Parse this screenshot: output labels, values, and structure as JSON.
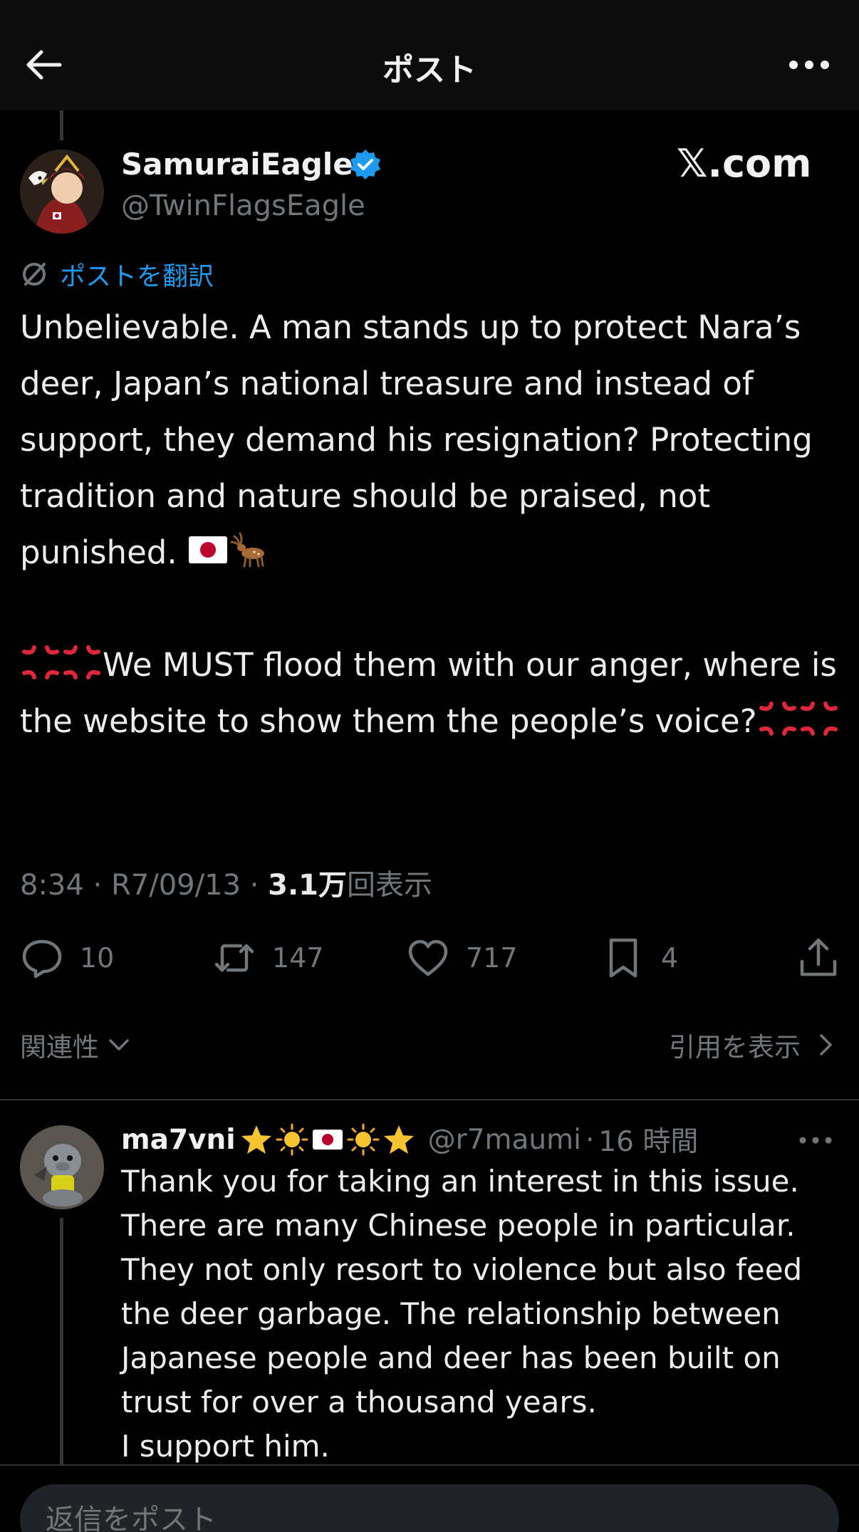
{
  "header": {
    "title": "ポスト",
    "back_icon": "arrow-left-icon",
    "more_icon": "more-horizontal-icon"
  },
  "author": {
    "display_name": "SamuraiEagle",
    "handle": "@TwinFlagsEagle",
    "verified": true,
    "brand_label": "𝕏.com"
  },
  "translate": {
    "label": "ポストを翻訳"
  },
  "post": {
    "line1": "Unbelievable. A man stands up to protect Nara’s deer, Japan’s national treasure and instead of support, they demand his resignation? Protecting tradition and nature should be praised, not punished. ",
    "line2": "We MUST flood them with our anger, where is the website to show them the people’s voice?",
    "emojis_first": [
      "flag-japan",
      "deer"
    ],
    "emojis_anger": [
      "anger-symbol",
      "anger-symbol"
    ]
  },
  "meta": {
    "time": "8:34",
    "separator": "·",
    "date": "R7/09/13",
    "views_num": "3.1万",
    "views_label": "回表示"
  },
  "actions": {
    "replies": "10",
    "reposts": "147",
    "likes": "717",
    "bookmarks": "4"
  },
  "filters": {
    "sort_label": "関連性",
    "quotes_label": "引用を表示"
  },
  "reply": {
    "display_name": "ma7vni",
    "name_emojis": [
      "star",
      "sun",
      "flag-japan",
      "sun",
      "star"
    ],
    "handle": "@r7maumi",
    "separator": "·",
    "time": "16 時間",
    "text": "Thank you for taking an interest in this issue. There are many Chinese people in particular. They not only resort to violence but also feed the deer garbage. The relationship between Japanese people and deer has been built on trust for over a thousand years.\nI support him."
  },
  "composer": {
    "placeholder": "返信をポスト"
  },
  "colors": {
    "accent": "#1d9bf0",
    "muted": "#71767b",
    "text": "#e7e9ea",
    "background": "#000000",
    "anger": "#e0263a"
  }
}
